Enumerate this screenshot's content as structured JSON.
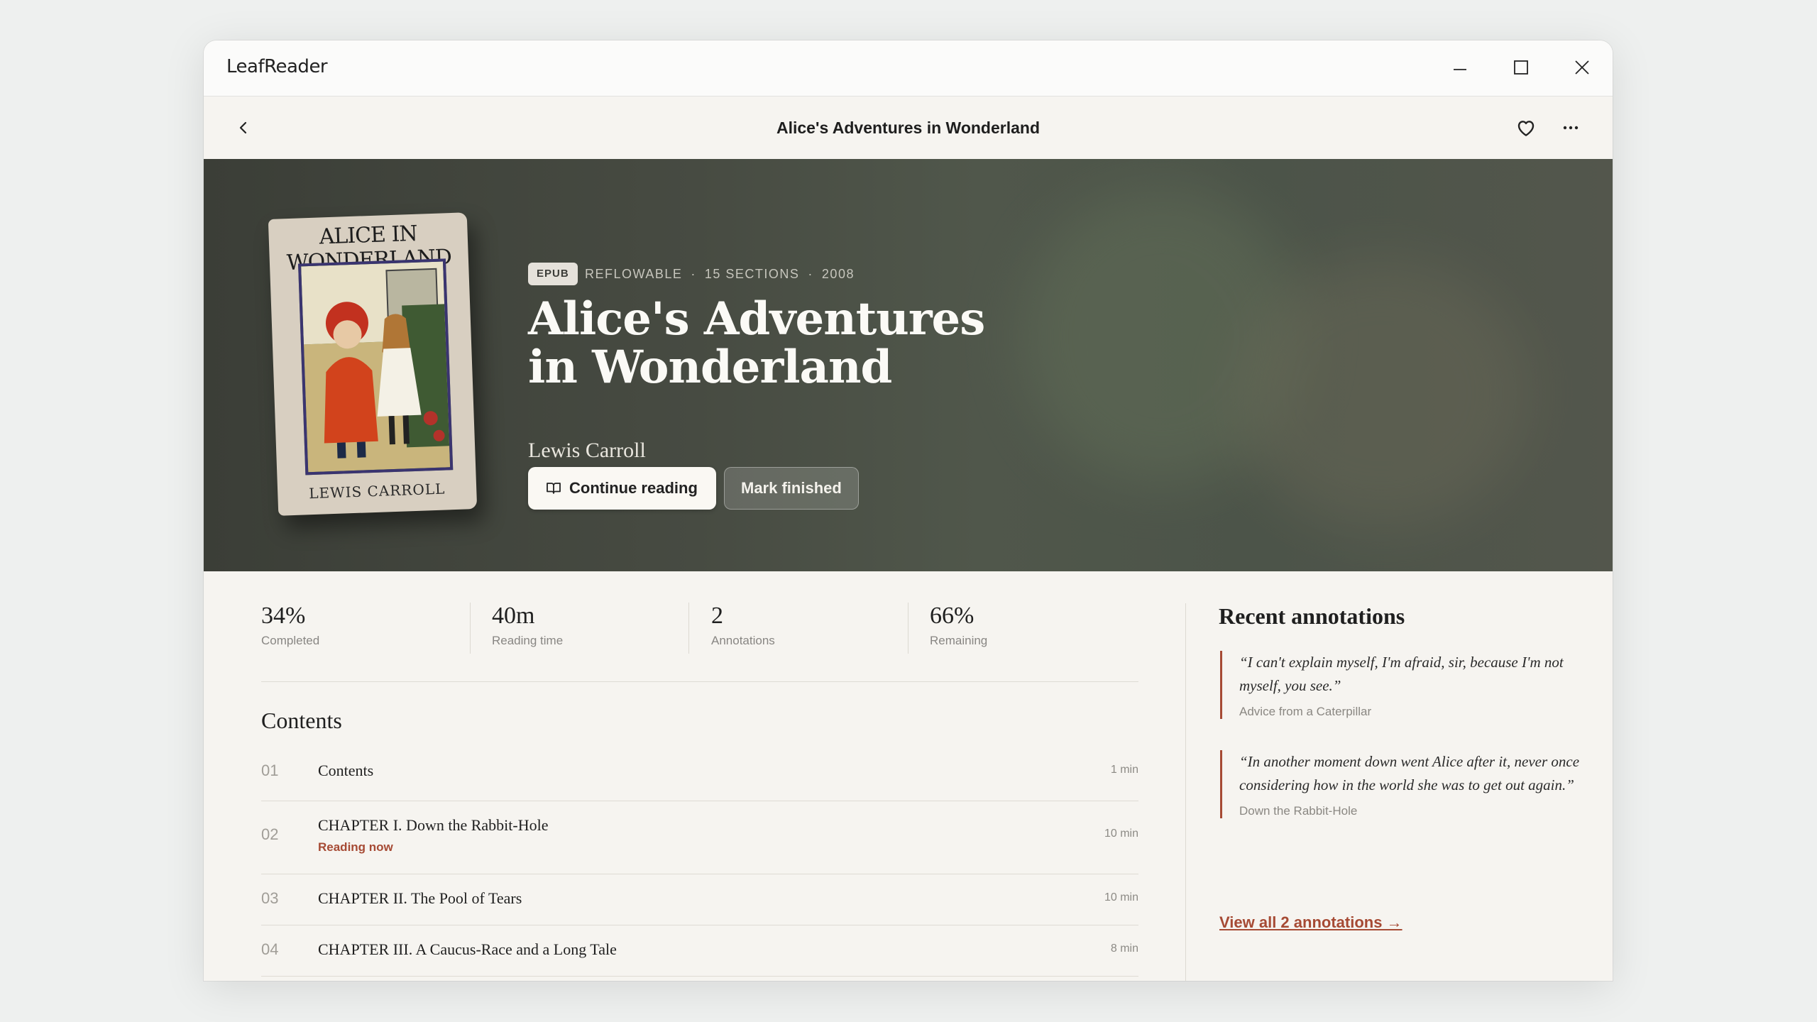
{
  "window": {
    "app_name": "LeafReader"
  },
  "topbar": {
    "title": "Alice's Adventures in Wonderland"
  },
  "book": {
    "format_badge": "EPUB",
    "meta": [
      "REFLOWABLE",
      "15 SECTIONS",
      "2008"
    ],
    "title": "Alice's Adventures in Wonderland",
    "author": "Lewis Carroll",
    "cover": {
      "title": "ALICE IN WONDERLAND",
      "author": "LEWIS CARROLL"
    }
  },
  "actions": {
    "continue_label": "Continue reading",
    "finish_label": "Mark finished"
  },
  "stats": [
    {
      "value": "34%",
      "label": "Completed"
    },
    {
      "value": "40m",
      "label": "Reading time"
    },
    {
      "value": "2",
      "label": "Annotations"
    },
    {
      "value": "66%",
      "label": "Remaining"
    }
  ],
  "contents": {
    "heading": "Contents",
    "items": [
      {
        "num": "01",
        "title": "Contents",
        "duration": "1 min",
        "status": ""
      },
      {
        "num": "02",
        "title": "CHAPTER I. Down the Rabbit-Hole",
        "duration": "10 min",
        "status": "Reading now"
      },
      {
        "num": "03",
        "title": "CHAPTER II. The Pool of Tears",
        "duration": "10 min",
        "status": ""
      },
      {
        "num": "04",
        "title": "CHAPTER III. A Caucus-Race and a Long Tale",
        "duration": "8 min",
        "status": ""
      }
    ]
  },
  "annotations": {
    "heading": "Recent annotations",
    "items": [
      {
        "quote": "“I can't explain myself, I'm afraid, sir, because I'm not myself, you see.”",
        "source": "Advice from a Caterpillar"
      },
      {
        "quote": "“In another moment down went Alice after it, never once considering how in the world she was to get out again.”",
        "source": "Down the Rabbit-Hole"
      }
    ],
    "view_all": "View all 2 annotations →"
  },
  "colors": {
    "accent": "#a64a34",
    "background": "#f6f4f0",
    "hero": "#474b42"
  }
}
